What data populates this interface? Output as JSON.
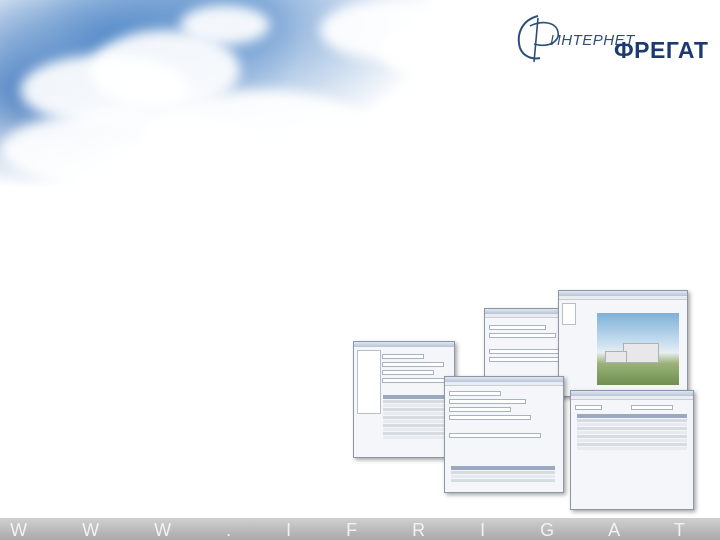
{
  "brand": {
    "logo_word_top": "ИНТЕРНЕТ",
    "logo_word_main": "ФРЕГАТ",
    "logo_initial": "Ф"
  },
  "footer": {
    "url_text": "W W W . I F R I G A T E . R U"
  },
  "screenshots": {
    "count": 4,
    "items": [
      "catalog-window",
      "record-form-window",
      "photo-viewer-window",
      "records-table-window"
    ]
  },
  "colors": {
    "sky_blue": "#4e86c7",
    "logo_blue": "#1d3a70",
    "footer_gray": "#bdbdbd"
  }
}
